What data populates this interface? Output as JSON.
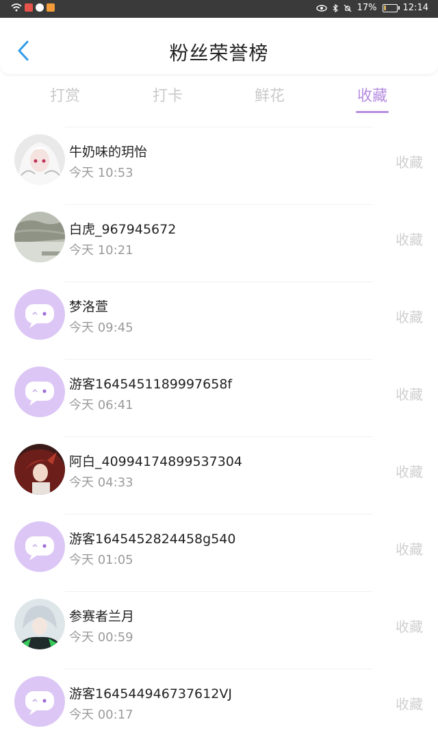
{
  "status_bar": {
    "battery": "17%",
    "battery_level": 0.17,
    "time": "12:14"
  },
  "header": {
    "title": "粉丝荣誉榜"
  },
  "tabs": [
    {
      "label": "打赏",
      "active": false
    },
    {
      "label": "打卡",
      "active": false
    },
    {
      "label": "鲜花",
      "active": false
    },
    {
      "label": "收藏",
      "active": true
    }
  ],
  "colors": {
    "accent": "#b58be0",
    "default_avatar": "#dcc6f5"
  },
  "fans": [
    {
      "name": "牛奶味的玥怡",
      "time": "今天 10:53",
      "action": "收藏",
      "avatar": "photo-anime-white-hair"
    },
    {
      "name": "白虎_967945672",
      "time": "今天 10:21",
      "action": "收藏",
      "avatar": "photo-gray"
    },
    {
      "name": "梦洛萱",
      "time": "今天 09:45",
      "action": "收藏",
      "avatar": "default-chat-bubble"
    },
    {
      "name": "游客1645451189997658f",
      "time": "今天 06:41",
      "action": "收藏",
      "avatar": "default-chat-bubble"
    },
    {
      "name": "阿白_40994174899537304",
      "time": "今天 04:33",
      "action": "收藏",
      "avatar": "photo-anime-dark"
    },
    {
      "name": "游客1645452824458g540",
      "time": "今天 01:05",
      "action": "收藏",
      "avatar": "default-chat-bubble"
    },
    {
      "name": "参赛者兰月",
      "time": "今天 00:59",
      "action": "收藏",
      "avatar": "photo-anime-cyber"
    },
    {
      "name": "游客164544946737612VJ",
      "time": "今天 00:17",
      "action": "收藏",
      "avatar": "default-chat-bubble"
    }
  ]
}
